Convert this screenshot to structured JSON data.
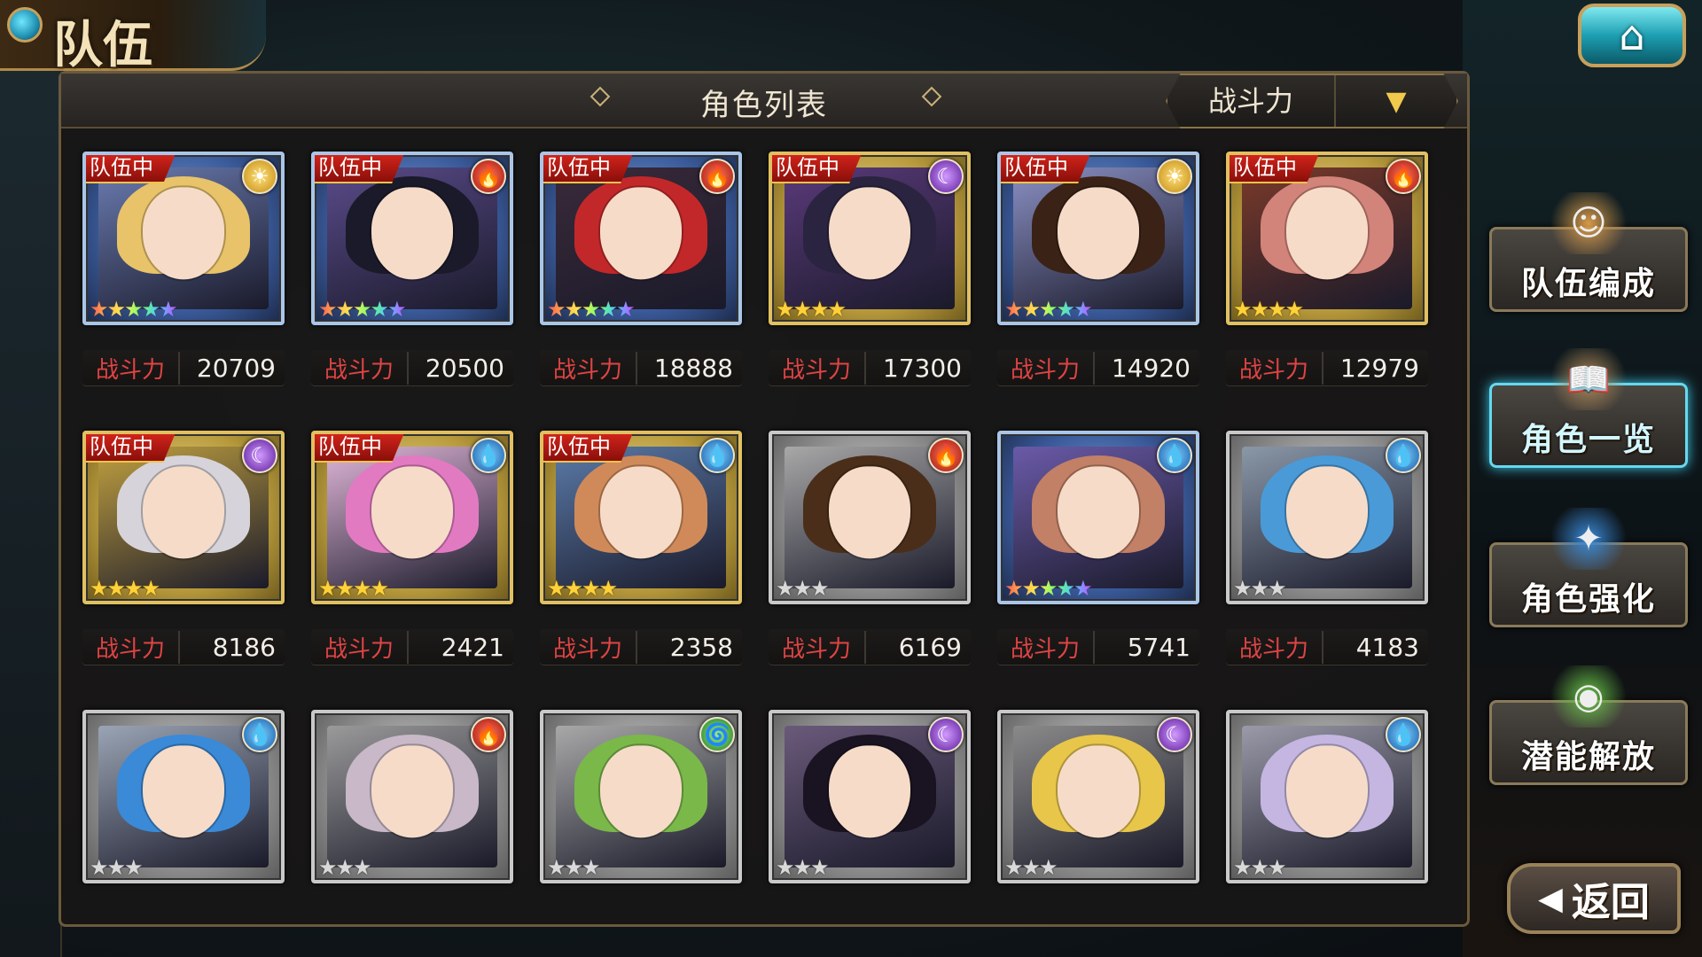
{
  "header": {
    "title": "队伍",
    "home_icon": "home-icon"
  },
  "panel": {
    "title": "角色列表",
    "sort_label": "战斗力",
    "sort_arrow": "▼"
  },
  "team_tag": "队伍中",
  "power_label": "战斗力",
  "characters": [
    {
      "in_team": true,
      "element": "sun",
      "element_glyph": "☀",
      "stars": 5,
      "star_style": "rainbow",
      "frame": "blue",
      "power": "20709",
      "hair": "#e8c36a",
      "bg": "#6a7bb0"
    },
    {
      "in_team": true,
      "element": "fire",
      "element_glyph": "🔥",
      "stars": 5,
      "star_style": "rainbow",
      "frame": "blue",
      "power": "20500",
      "hair": "#1a1a2a",
      "bg": "#5a4b8a"
    },
    {
      "in_team": true,
      "element": "fire",
      "element_glyph": "🔥",
      "stars": 5,
      "star_style": "rainbow",
      "frame": "blue",
      "power": "18888",
      "hair": "#c2282a",
      "bg": "#3a2a3a"
    },
    {
      "in_team": true,
      "element": "moon",
      "element_glyph": "☾",
      "stars": 4,
      "star_style": "gold",
      "frame": "gold",
      "power": "17300",
      "hair": "#2a2440",
      "bg": "#5a3a7a"
    },
    {
      "in_team": true,
      "element": "sun",
      "element_glyph": "☀",
      "stars": 5,
      "star_style": "rainbow",
      "frame": "blue",
      "power": "14920",
      "hair": "#3a2216",
      "bg": "#8a90c4"
    },
    {
      "in_team": true,
      "element": "fire",
      "element_glyph": "🔥",
      "stars": 4,
      "star_style": "gold",
      "frame": "gold",
      "power": "12979",
      "hair": "#d2847a",
      "bg": "#7a3a2a"
    },
    {
      "in_team": true,
      "element": "moon",
      "element_glyph": "☾",
      "stars": 4,
      "star_style": "gold",
      "frame": "gold",
      "power": "8186",
      "hair": "#d6d4da",
      "bg": "#c0a040"
    },
    {
      "in_team": true,
      "element": "water",
      "element_glyph": "💧",
      "stars": 4,
      "star_style": "gold",
      "frame": "gold",
      "power": "2421",
      "hair": "#e27ac2",
      "bg": "#e0b6d8"
    },
    {
      "in_team": true,
      "element": "water",
      "element_glyph": "💧",
      "stars": 4,
      "star_style": "gold",
      "frame": "gold",
      "power": "2358",
      "hair": "#d08a5a",
      "bg": "#5a7aa8"
    },
    {
      "in_team": false,
      "element": "fire",
      "element_glyph": "🔥",
      "stars": 3,
      "star_style": "silver",
      "frame": "silver",
      "power": "6169",
      "hair": "#4a2e1a",
      "bg": "#a8a8a8"
    },
    {
      "in_team": false,
      "element": "water",
      "element_glyph": "💧",
      "stars": 5,
      "star_style": "rainbow",
      "frame": "blue",
      "power": "5741",
      "hair": "#c28066",
      "bg": "#6a5aa8"
    },
    {
      "in_team": false,
      "element": "water",
      "element_glyph": "💧",
      "stars": 3,
      "star_style": "silver",
      "frame": "silver",
      "power": "4183",
      "hair": "#4a9ad8",
      "bg": "#8a98a8"
    },
    {
      "in_team": false,
      "element": "water",
      "element_glyph": "💧",
      "stars": 3,
      "star_style": "silver",
      "frame": "silver",
      "power": "",
      "hair": "#3a8ad8",
      "bg": "#9aa4b4"
    },
    {
      "in_team": false,
      "element": "fire",
      "element_glyph": "🔥",
      "stars": 3,
      "star_style": "silver",
      "frame": "silver",
      "power": "",
      "hair": "#c8b8c8",
      "bg": "#9a9a9a"
    },
    {
      "in_team": false,
      "element": "wind",
      "element_glyph": "🌀",
      "stars": 3,
      "star_style": "silver",
      "frame": "silver",
      "power": "",
      "hair": "#7ab84a",
      "bg": "#a8a8a8"
    },
    {
      "in_team": false,
      "element": "moon",
      "element_glyph": "☾",
      "stars": 3,
      "star_style": "silver",
      "frame": "silver",
      "power": "",
      "hair": "#1a1422",
      "bg": "#6a5a7a"
    },
    {
      "in_team": false,
      "element": "moon",
      "element_glyph": "☾",
      "stars": 3,
      "star_style": "silver",
      "frame": "silver",
      "power": "",
      "hair": "#e8c64a",
      "bg": "#8a8a8a"
    },
    {
      "in_team": false,
      "element": "water",
      "element_glyph": "💧",
      "stars": 3,
      "star_style": "silver",
      "frame": "silver",
      "power": "",
      "hair": "#c4b6e0",
      "bg": "#9a9aa8"
    }
  ],
  "side_menu": [
    {
      "label": "队伍编成",
      "icon": "party-members-icon",
      "active": false
    },
    {
      "label": "角色一览",
      "icon": "character-book-icon",
      "active": true
    },
    {
      "label": "角色强化",
      "icon": "enhance-orb-icon",
      "active": false
    },
    {
      "label": "潜能解放",
      "icon": "potential-orb-icon",
      "active": false
    }
  ],
  "back": {
    "label": "返回",
    "icon": "back-arrow-icon"
  }
}
